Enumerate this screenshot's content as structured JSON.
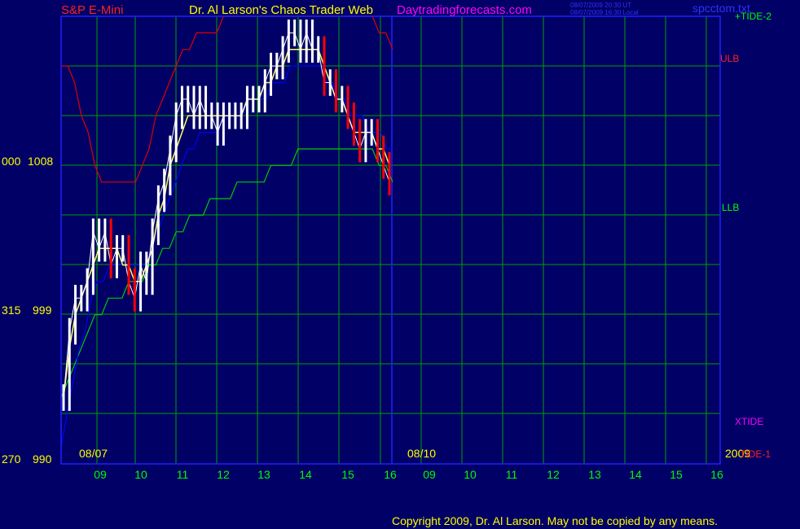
{
  "header": {
    "symbol": "S&P E-Mini",
    "title": "Dr. Al Larson's Chaos Trader Web",
    "site": "Daytradingforecasts.com",
    "timestamp_ut": "08/07/2009 20:30 UT",
    "timestamp_local": "08/07/2009 16:30 Local",
    "filename": "spcctom.txt"
  },
  "copyright": "Copyright 2009, Dr. Al Larson. May not be copied by any means.",
  "colors": {
    "background": "#000066",
    "grid": "#00a000",
    "frame": "#2020ff",
    "price": "#ffffff",
    "price_down": "#ff0000",
    "ma_fast": "#ffff66",
    "ma_slow": "#0000ff",
    "band_upper": "#dd0000",
    "band_lower": "#00cc00",
    "tide1": "#ff0000",
    "tide2": "#00cc00",
    "xtide": "#ff00ff",
    "date_label": "#ffff00",
    "hour_label": "#00ff00",
    "header_red": "#ff2020",
    "header_yellow": "#ffff00",
    "header_magenta": "#ff00ff",
    "header_blue": "#3030ff"
  },
  "chart_data": {
    "type": "line",
    "title": "S&P E-Mini",
    "y_axis_labels": [
      {
        "left": "000",
        "right": "1008"
      },
      {
        "left": "315",
        "right": "999"
      },
      {
        "left": "270",
        "right": "990"
      }
    ],
    "price_range": [
      990,
      1017
    ],
    "date_labels": [
      "08/07",
      "08/10",
      "2009"
    ],
    "hour_ticks": [
      "09",
      "10",
      "11",
      "12",
      "13",
      "14",
      "15",
      "16",
      "09",
      "10",
      "11",
      "12",
      "13",
      "14",
      "15",
      "16"
    ],
    "legend": [
      {
        "name": "+TIDE-2",
        "color": "#00ff00"
      },
      {
        "name": "ULB",
        "color": "#ff2020"
      },
      {
        "name": "LLB",
        "color": "#00ff00"
      },
      {
        "name": "XTIDE",
        "color": "#ff00ff"
      },
      {
        "name": "TIDE-1",
        "color": "#ff2020"
      }
    ],
    "price_close": [
      994,
      998,
      1000,
      1000,
      1001,
      1004,
      1003,
      1004,
      1002,
      1003,
      1003,
      1001,
      1000,
      1002,
      1001,
      1004,
      1006,
      1007,
      1009,
      1011,
      1012,
      1012,
      1011,
      1012,
      1011,
      1011,
      1010,
      1011,
      1011,
      1011,
      1011,
      1012,
      1012,
      1012,
      1013,
      1014,
      1014,
      1015,
      1016,
      1016,
      1015,
      1016,
      1015,
      1015,
      1013,
      1013,
      1012,
      1012,
      1011,
      1010,
      1009,
      1010,
      1010,
      1009,
      1008,
      1007
    ],
    "ma_fast": [
      994,
      997,
      999,
      1000,
      1001,
      1002,
      1003,
      1003,
      1003,
      1003,
      1002,
      1002,
      1001,
      1001,
      1002,
      1003,
      1005,
      1006,
      1008,
      1009,
      1010,
      1011,
      1011,
      1011,
      1011,
      1011,
      1011,
      1011,
      1011,
      1011,
      1011,
      1012,
      1012,
      1012,
      1013,
      1013,
      1014,
      1014,
      1015,
      1015,
      1015,
      1015,
      1015,
      1015,
      1014,
      1013,
      1012,
      1012,
      1011,
      1010,
      1010,
      1010,
      1010,
      1009,
      1009,
      1008
    ],
    "ma_slow": [
      991,
      993,
      995,
      997,
      998,
      1000,
      1001,
      1001,
      1002,
      1002,
      1002,
      1002,
      1002,
      1002,
      1002,
      1003,
      1004,
      1005,
      1006,
      1007,
      1008,
      1009,
      1009,
      1010,
      1010,
      1010,
      1010,
      1011,
      1011,
      1011,
      1011,
      1012,
      1012,
      1012,
      1012,
      1013,
      1013,
      1013,
      1014,
      1014,
      1014,
      1014,
      1014,
      1014,
      1013,
      1013,
      1012,
      1012,
      1011,
      1011,
      1011,
      1010,
      1010,
      1010,
      1009,
      1009
    ],
    "band_upper": [
      1014,
      1014,
      1013,
      1011,
      1010,
      1008,
      1007,
      1007,
      1007,
      1007,
      1007,
      1007,
      1008,
      1009,
      1011,
      1012,
      1013,
      1014,
      1015,
      1015,
      1016,
      1016,
      1016,
      1016,
      1017,
      1017,
      1017,
      1017,
      1017,
      1017,
      1017,
      1017,
      1017,
      1017,
      1017,
      1017,
      1017,
      1017,
      1017,
      1017,
      1017,
      1017,
      1017,
      1017,
      1017,
      1017,
      1017,
      1016,
      1016,
      1015
    ],
    "band_lower": [
      994,
      995,
      996,
      997,
      998,
      999,
      999,
      1000,
      1000,
      1000,
      1001,
      1001,
      1001,
      1002,
      1002,
      1003,
      1003,
      1004,
      1004,
      1005,
      1005,
      1005,
      1006,
      1006,
      1006,
      1006,
      1007,
      1007,
      1007,
      1007,
      1007,
      1008,
      1008,
      1008,
      1008,
      1009,
      1009,
      1009,
      1009,
      1009,
      1009,
      1009,
      1009,
      1009,
      1009,
      1009,
      1009,
      1008,
      1008,
      1007
    ]
  }
}
